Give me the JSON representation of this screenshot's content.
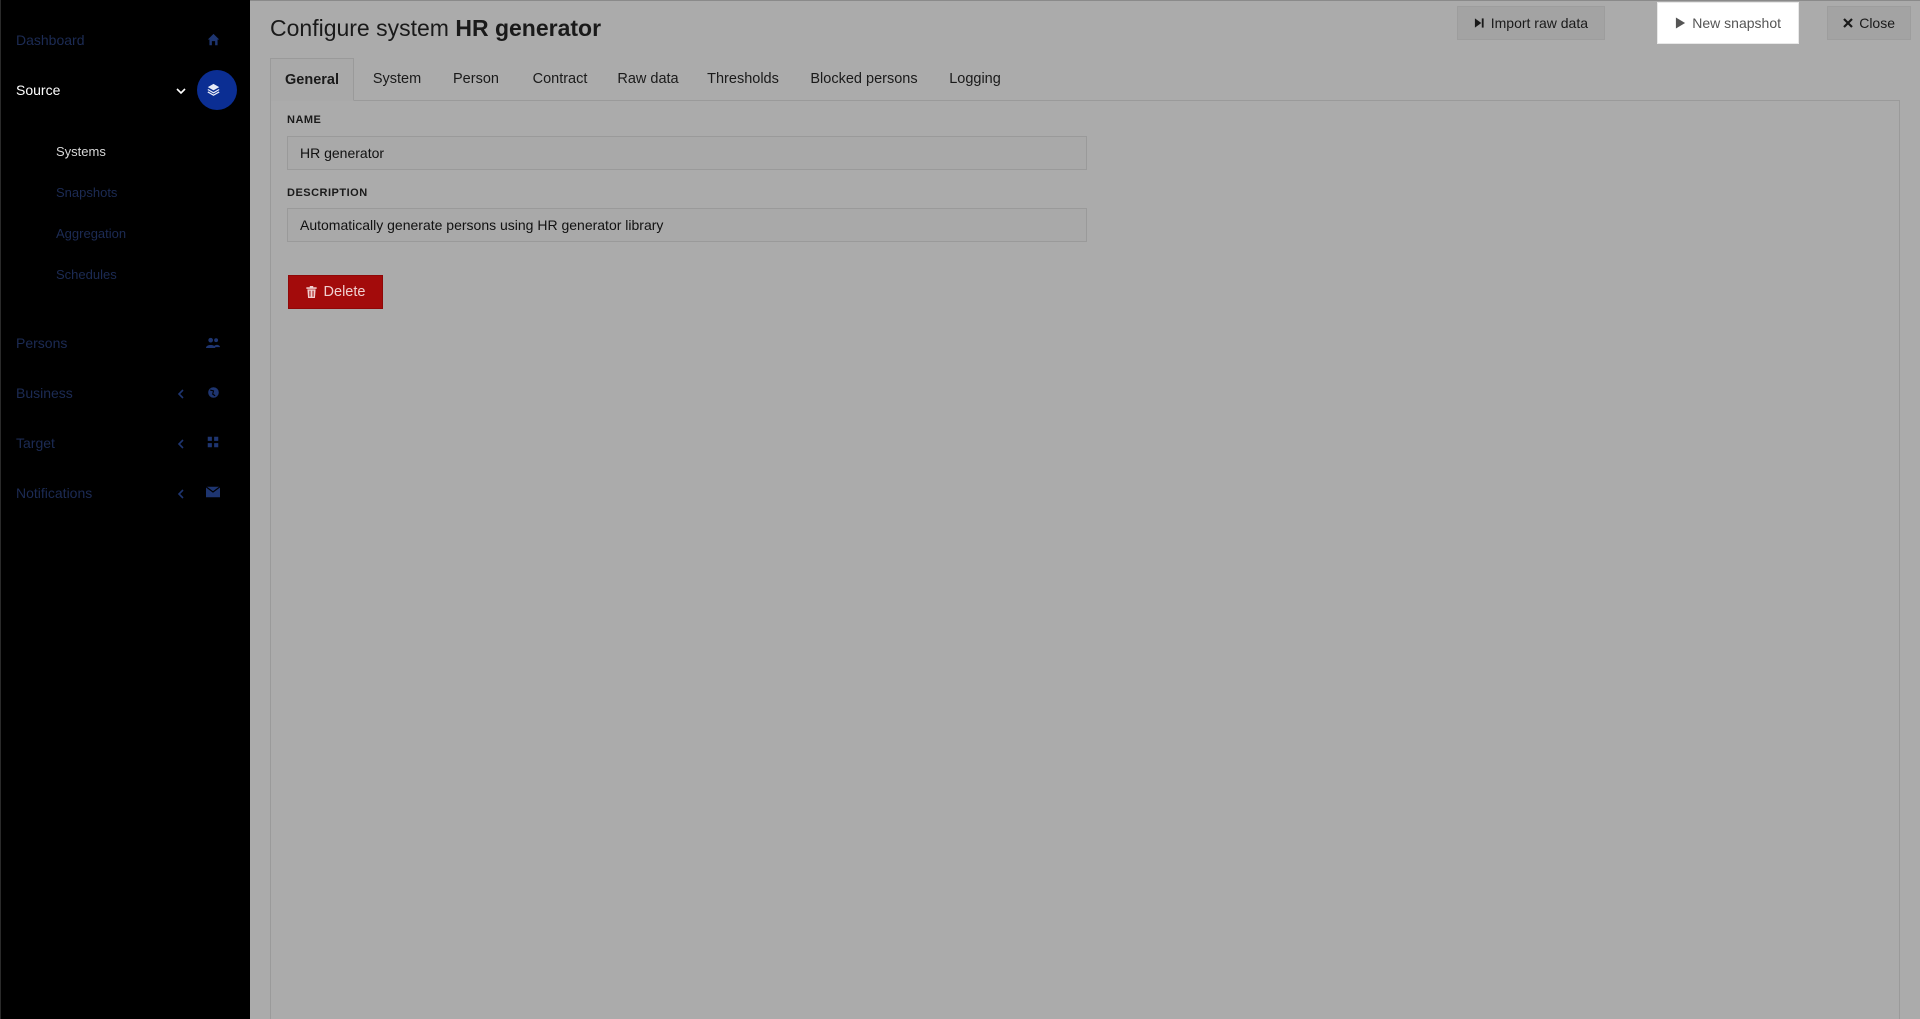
{
  "sidebar": {
    "items": [
      {
        "label": "Dashboard",
        "icon": "home-icon"
      },
      {
        "label": "Source",
        "icon": "layers-icon",
        "expanded": true
      },
      {
        "label": "Persons",
        "icon": "users-icon"
      },
      {
        "label": "Business",
        "icon": "globe-icon"
      },
      {
        "label": "Target",
        "icon": "grid-icon"
      },
      {
        "label": "Notifications",
        "icon": "envelope-icon"
      }
    ],
    "source_children": [
      {
        "label": "Systems",
        "active": true
      },
      {
        "label": "Snapshots"
      },
      {
        "label": "Aggregation"
      },
      {
        "label": "Schedules"
      }
    ]
  },
  "header": {
    "title_prefix": "Configure system",
    "title_name": "HR generator",
    "actions": {
      "import_label": "Import raw data",
      "snapshot_label": "New snapshot",
      "close_label": "Close"
    }
  },
  "tabs": [
    {
      "label": "General",
      "active": true
    },
    {
      "label": "System"
    },
    {
      "label": "Person"
    },
    {
      "label": "Contract"
    },
    {
      "label": "Raw data"
    },
    {
      "label": "Thresholds"
    },
    {
      "label": "Blocked persons"
    },
    {
      "label": "Logging"
    }
  ],
  "form": {
    "name_label": "NAME",
    "name_value": "HR generator",
    "description_label": "DESCRIPTION",
    "description_value": "Automatically generate persons using HR generator library",
    "delete_label": "Delete"
  },
  "colors": {
    "accent": "#0b2e93",
    "danger": "#a30b0b",
    "overlay": "#ababab"
  }
}
